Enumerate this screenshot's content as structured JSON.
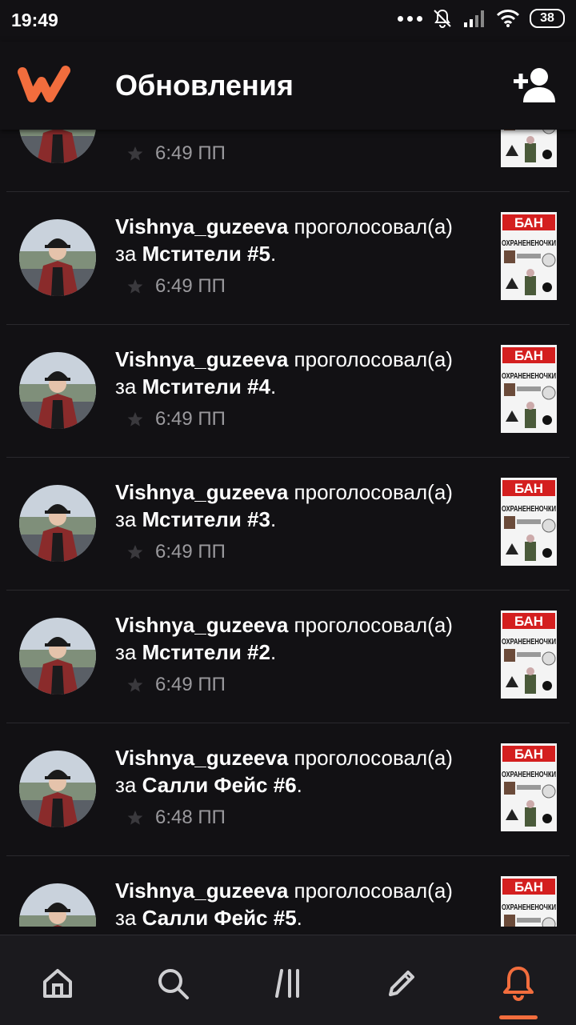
{
  "status_bar": {
    "time": "19:49",
    "battery": "38"
  },
  "header": {
    "title": "Обновления"
  },
  "feed": [
    {
      "time": "6:49 ПП",
      "partial": true
    },
    {
      "user": "Vishnya_guzeeva",
      "action": "проголосовал(а)",
      "prep": "за",
      "story": "Мстители #5",
      "time": "6:49 ПП"
    },
    {
      "user": "Vishnya_guzeeva",
      "action": "проголосовал(а)",
      "prep": "за",
      "story": "Мстители #4",
      "time": "6:49 ПП"
    },
    {
      "user": "Vishnya_guzeeva",
      "action": "проголосовал(а)",
      "prep": "за",
      "story": "Мстители #3",
      "time": "6:49 ПП"
    },
    {
      "user": "Vishnya_guzeeva",
      "action": "проголосовал(а)",
      "prep": "за",
      "story": "Мстители #2",
      "time": "6:49 ПП"
    },
    {
      "user": "Vishnya_guzeeva",
      "action": "проголосовал(а)",
      "prep": "за",
      "story": "Салли Фейс #6",
      "time": "6:48 ПП"
    },
    {
      "user": "Vishnya_guzeeva",
      "action": "проголосовал(а)",
      "prep": "за",
      "story": "Салли Фейс #5",
      "time": ""
    }
  ],
  "thumbnail": {
    "top_text": "БАН",
    "mid_text": "ОХРАНЕНЕНОЧКИ"
  },
  "bottom_nav": [
    "home",
    "search",
    "library",
    "write",
    "notifications"
  ],
  "colors": {
    "accent": "#f26d3d",
    "background": "#121114"
  }
}
